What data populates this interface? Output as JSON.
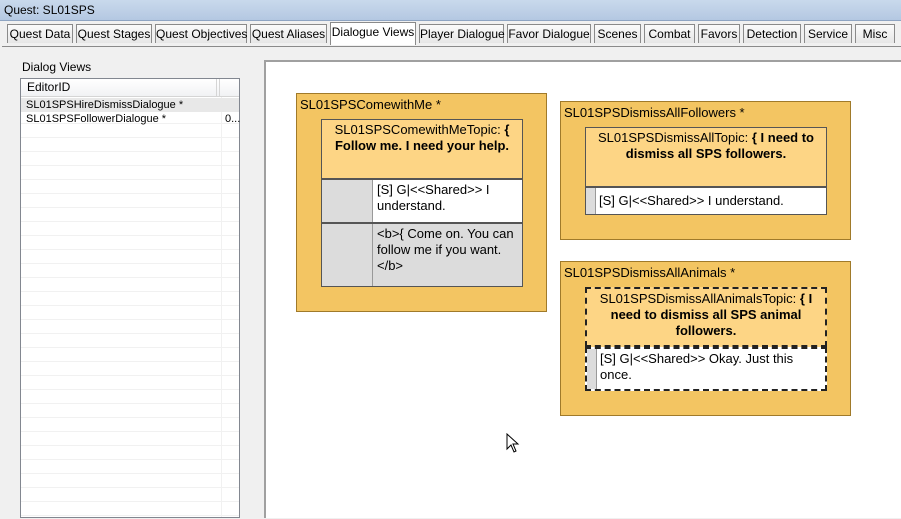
{
  "window": {
    "title": "Quest: SL01SPS"
  },
  "tabs": [
    {
      "label": "Quest Data"
    },
    {
      "label": "Quest Stages"
    },
    {
      "label": "Quest Objectives"
    },
    {
      "label": "Quest Aliases"
    },
    {
      "label": "Dialogue Views"
    },
    {
      "label": "Player Dialogue"
    },
    {
      "label": "Favor Dialogue"
    },
    {
      "label": "Scenes"
    },
    {
      "label": "Combat"
    },
    {
      "label": "Favors"
    },
    {
      "label": "Detection"
    },
    {
      "label": "Service"
    },
    {
      "label": "Misc"
    }
  ],
  "active_tab": "Dialogue Views",
  "dialog_views": {
    "group_label": "Dialog Views",
    "column_header": "EditorID",
    "rows": [
      {
        "name": "SL01SPSHireDismissDialogue *",
        "value": ""
      },
      {
        "name": "SL01SPSFollowerDialogue *",
        "value": "0..."
      }
    ]
  },
  "branches": [
    {
      "title": "SL01SPSComewithMe *",
      "topic_prefix": "SL01SPSComewithMeTopic: ",
      "topic_bold": "{ Follow me. I need your help.",
      "responses": [
        "[S] G|<<Shared>> I understand.",
        "<b>{ Come on. You can follow me if you want.</b>"
      ]
    },
    {
      "title": "SL01SPSDismissAllFollowers *",
      "topic_prefix": "SL01SPSDismissAllTopic: ",
      "topic_bold": "{ I need to dismiss all SPS followers.",
      "responses": [
        "[S] G|<<Shared>> I understand."
      ]
    },
    {
      "title": "SL01SPSDismissAllAnimals *",
      "topic_prefix": "SL01SPSDismissAllAnimalsTopic: ",
      "topic_bold": "{ I need to dismiss all SPS animal followers.",
      "responses": [
        "[S] G|<<Shared>> Okay. Just this once."
      ]
    }
  ],
  "colors": {
    "branch_fill": "#f3c562",
    "topic_fill": "#fdd585",
    "gutter": "#dcdcdc"
  }
}
